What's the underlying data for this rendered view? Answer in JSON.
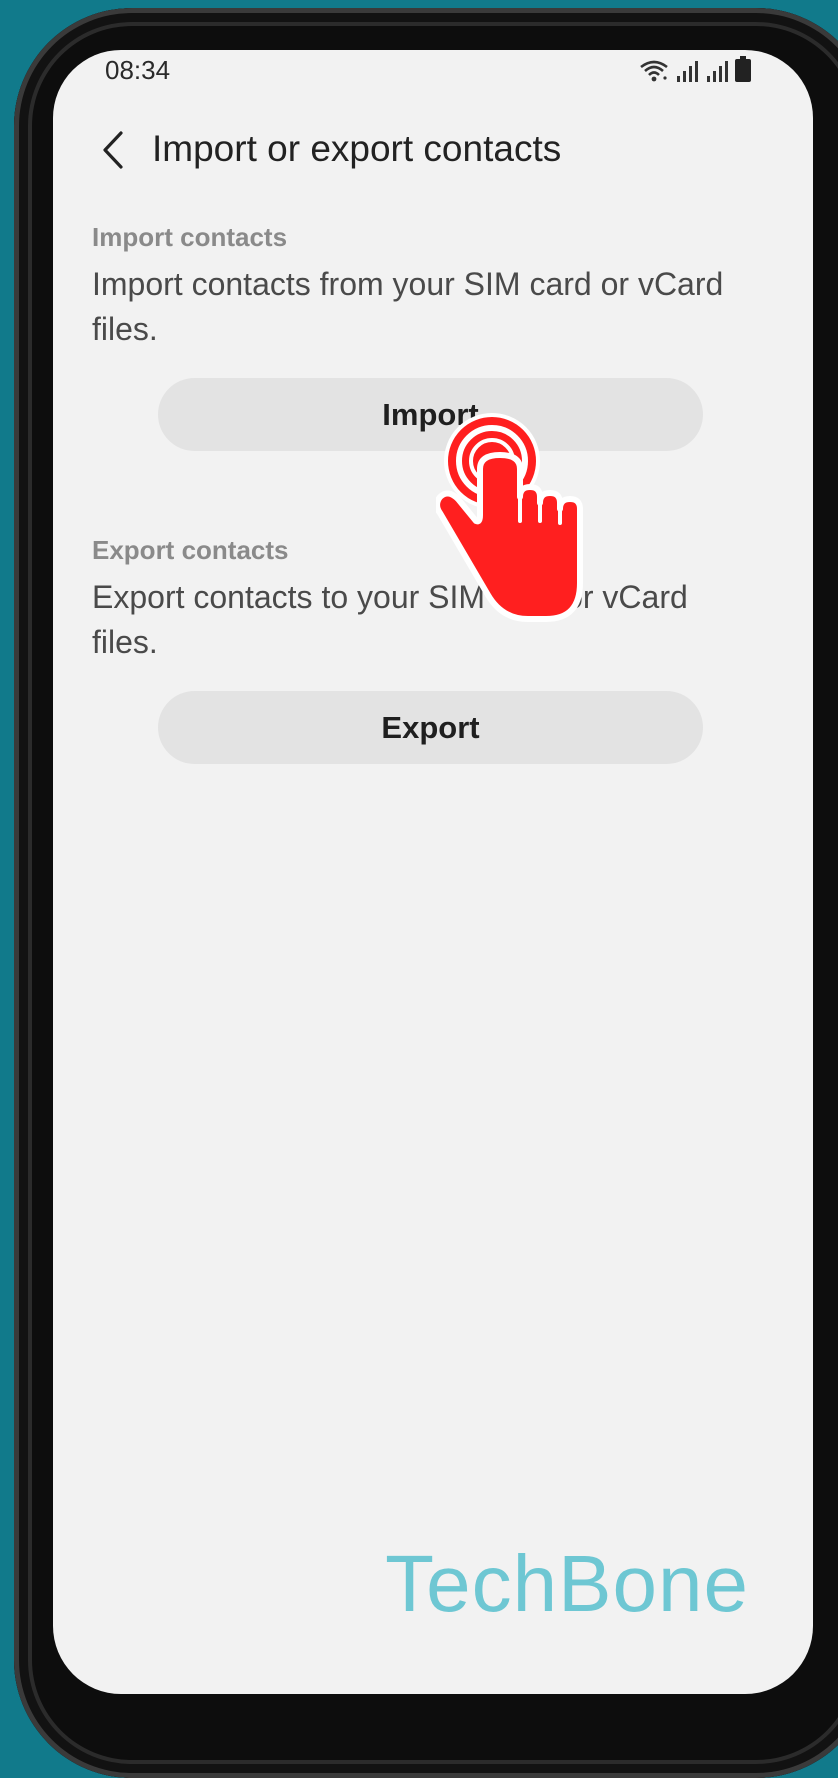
{
  "status_bar": {
    "time": "08:34",
    "icons": [
      "wifi-icon",
      "signal-icon",
      "signal-icon",
      "battery-icon"
    ]
  },
  "app_bar": {
    "back_icon": "chevron-left-icon",
    "title": "Import or export contacts"
  },
  "import_section": {
    "header": "Import contacts",
    "description": "Import contacts from your SIM card or vCard files.",
    "button_label": "Import"
  },
  "export_section": {
    "header": "Export contacts",
    "description": "Export contacts to your SIM card or vCard files.",
    "button_label": "Export"
  },
  "overlay": {
    "tap_indicator_icon": "tap-hand-icon",
    "tap_color": "#ff1f1f"
  },
  "watermark": {
    "text": "TechBone",
    "color": "#6ec7d3"
  }
}
